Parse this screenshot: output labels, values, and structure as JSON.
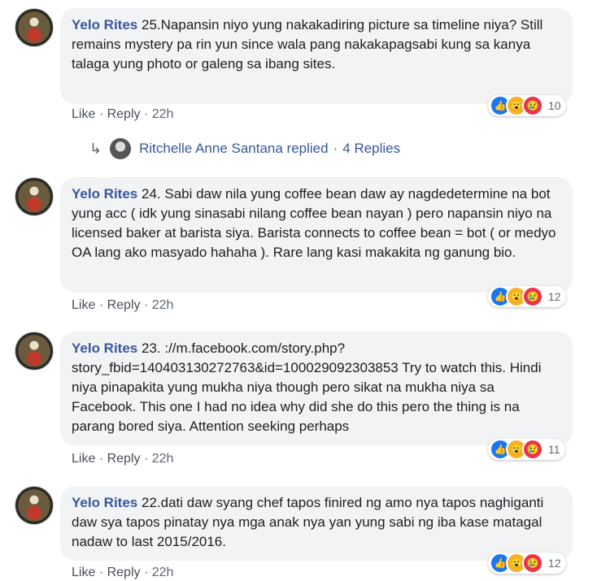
{
  "comments": [
    {
      "author": "Yelo Rites",
      "text": "25.Napansin niyo yung nakakadiring picture sa timeline niya? Still remains mystery pa rin yun since wala pang nakakapagsabi kung sa kanya talaga yung photo or galeng sa ibang sites.",
      "like": "Like",
      "reply": "Reply",
      "time": "22h",
      "reaction_count": "10"
    },
    {
      "author": "Yelo Rites",
      "text": "24. Sabi daw nila yung coffee bean daw ay nagdedetermine na bot yung acc ( idk yung sinasabi nilang coffee bean nayan ) pero napansin niyo na licensed baker at barista siya. Barista connects to coffee bean = bot ( or medyo OA lang ako masyado hahaha ). Rare lang kasi makakita ng ganung bio.",
      "like": "Like",
      "reply": "Reply",
      "time": "22h",
      "reaction_count": "12"
    },
    {
      "author": "Yelo Rites",
      "text": "23. ://m.facebook.com/story.php?story_fbid=140403130272763&id=100029092303853 Try to watch this. Hindi niya pinapakita yung mukha niya though pero sikat na mukha niya sa Facebook. This one I had no idea why did she do this pero the thing is na parang bored siya. Attention seeking perhaps",
      "like": "Like",
      "reply": "Reply",
      "time": "22h",
      "reaction_count": "11"
    },
    {
      "author": "Yelo Rites",
      "text": "22.dati daw syang chef tapos finired ng amo nya tapos naghiganti daw sya tapos pinatay nya mga anak nya yan yung sabi ng iba kase matagal nadaw to last 2015/2016.",
      "like": "Like",
      "reply": "Reply",
      "time": "22h",
      "reaction_count": "12"
    }
  ],
  "replies_line": {
    "name": "Ritchelle Anne Santana replied",
    "separator": "·",
    "count": "4 Replies"
  },
  "icons": [
    "reply-arrow-icon",
    "like-reaction-icon",
    "wow-reaction-icon",
    "sad-reaction-icon"
  ],
  "colors": {
    "author": "#385898",
    "bubble": "#f2f3f5",
    "like": "#1877f2",
    "wow": "#f7b125",
    "sad": "#e9344b"
  }
}
